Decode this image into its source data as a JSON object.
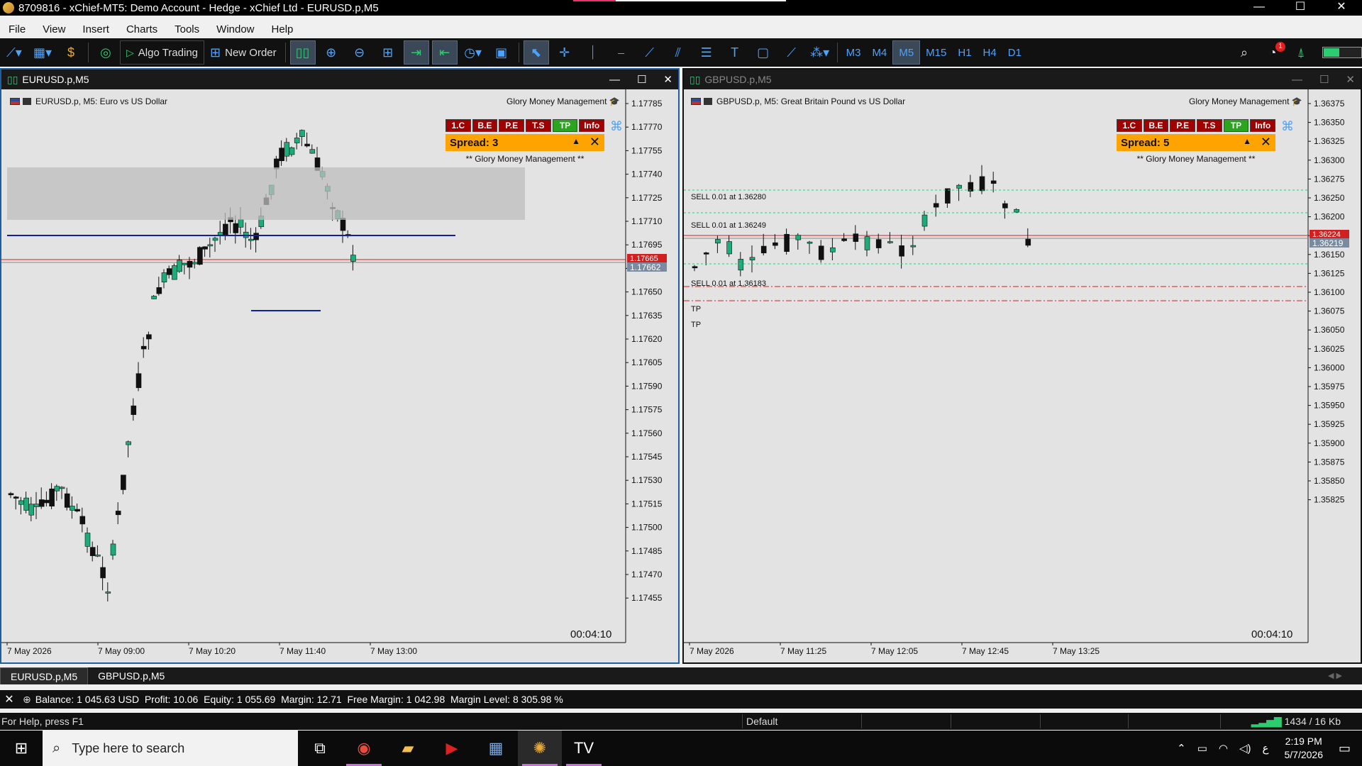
{
  "window": {
    "title": "8709816 - xChief-MT5: Demo Account - Hedge - xChief Ltd - EURUSD.p,M5",
    "minimize": "—",
    "maximize": "☐",
    "close": "✕"
  },
  "menu": [
    "File",
    "View",
    "Insert",
    "Charts",
    "Tools",
    "Window",
    "Help"
  ],
  "toolbar": {
    "algo_trading": "Algo Trading",
    "new_order": "New Order",
    "timeframes": [
      "M3",
      "M4",
      "M5",
      "M15",
      "H1",
      "H4",
      "D1"
    ],
    "active_timeframe": "M5",
    "notification_count": "1"
  },
  "charts": [
    {
      "window_title": "EURUSD.p,M5",
      "symbol_label": "EURUSD.p, M5:  Euro vs US Dollar",
      "indicator": "Glory Money Management",
      "panel_buttons": [
        "1.C",
        "B.E",
        "P.E",
        "T.S",
        "TP",
        "Info"
      ],
      "spread": "Spread: 3",
      "panel_footer": "**  Glory Money Management  **",
      "timer": "00:04:10",
      "price_ticks": [
        "1.17785",
        "1.17770",
        "1.17755",
        "1.17740",
        "1.17725",
        "1.17710",
        "1.17695",
        "1.17680",
        "1.17650",
        "1.17635",
        "1.17620",
        "1.17605",
        "1.17590",
        "1.17575",
        "1.17560",
        "1.17545",
        "1.17530",
        "1.17515",
        "1.17500",
        "1.17485",
        "1.17470",
        "1.17455"
      ],
      "current_price": "1.17662",
      "bid_price": "1.17665",
      "time_ticks": [
        "7 May 2026",
        "7 May 09:00",
        "7 May 10:20",
        "7 May 11:40",
        "7 May 13:00"
      ]
    },
    {
      "window_title": "GBPUSD.p,M5",
      "symbol_label": "GBPUSD.p, M5:  Great Britain Pound vs US Dollar",
      "indicator": "Glory Money Management",
      "panel_buttons": [
        "1.C",
        "B.E",
        "P.E",
        "T.S",
        "TP",
        "Info"
      ],
      "spread": "Spread: 5",
      "panel_footer": "**  Glory Money Management  **",
      "timer": "00:04:10",
      "price_ticks": [
        "1.36375",
        "1.36350",
        "1.36325",
        "1.36300",
        "1.36275",
        "1.36250",
        "1.36200",
        "1.36175",
        "1.36150",
        "1.36125",
        "1.36100",
        "1.36075",
        "1.36050",
        "1.36025",
        "1.36000",
        "1.35975",
        "1.35950",
        "1.35925",
        "1.35900",
        "1.35875",
        "1.35850",
        "1.35825"
      ],
      "current_price": "1.36219",
      "bid_price": "1.36224",
      "orders": [
        "SELL 0.01 at 1.36280",
        "SELL 0.01 at 1.36249",
        "SELL 0.01 at 1.36183",
        "TP",
        "TP"
      ],
      "time_ticks": [
        "7 May 2026",
        "7 May 11:25",
        "7 May 12:05",
        "7 May 12:45",
        "7 May 13:25"
      ]
    }
  ],
  "tabs": [
    "EURUSD.p,M5",
    "GBPUSD.p,M5"
  ],
  "account": {
    "balance": "Balance: 1 045.63 USD",
    "profit": "Profit: 10.06",
    "equity": "Equity: 1 055.69",
    "margin": "Margin: 12.71",
    "free_margin": "Free Margin: 1 042.98",
    "margin_level": "Margin Level: 8 305.98 %"
  },
  "status": {
    "help": "For Help, press F1",
    "profile": "Default",
    "traffic": "1434 / 16 Kb"
  },
  "taskbar": {
    "search_placeholder": "Type here to search",
    "time": "2:19 PM",
    "date": "5/7/2026",
    "lang": "ع"
  }
}
